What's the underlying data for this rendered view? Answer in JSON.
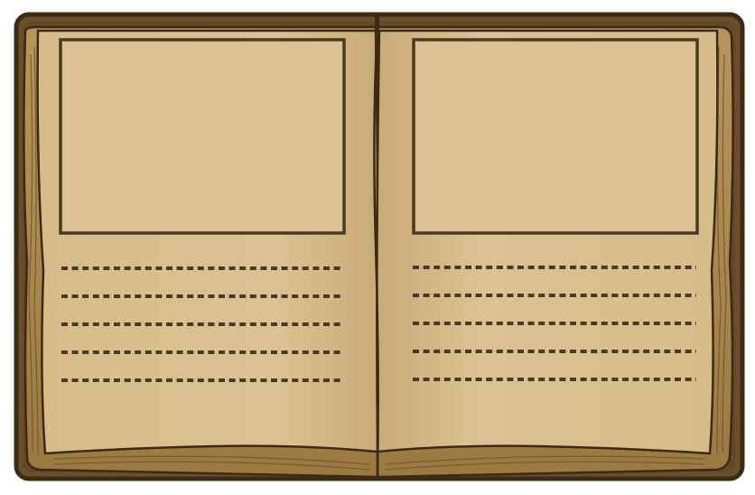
{
  "scene": {
    "subject": "open-book",
    "colors": {
      "outline": "#3d2a16",
      "cover": "#6b4f2a",
      "cover_dark": "#4a3519",
      "page_edges": "#c9a66b",
      "page_edges_shadow": "#a88548",
      "paper": "#dcc293",
      "paper_light": "#e2cb9f",
      "paper_shade": "#cfb27e",
      "frame": "#4a3a22",
      "dots": "#4a3a22"
    }
  },
  "pages": [
    {
      "side": "left",
      "picture_frame": true,
      "writing_lines": 5
    },
    {
      "side": "right",
      "picture_frame": true,
      "writing_lines": 5
    }
  ]
}
